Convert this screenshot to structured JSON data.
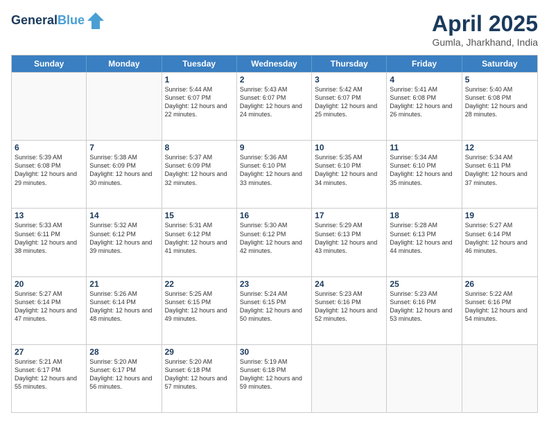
{
  "header": {
    "logo_line1": "General",
    "logo_line2": "Blue",
    "month": "April 2025",
    "location": "Gumla, Jharkhand, India"
  },
  "days_of_week": [
    "Sunday",
    "Monday",
    "Tuesday",
    "Wednesday",
    "Thursday",
    "Friday",
    "Saturday"
  ],
  "weeks": [
    [
      {
        "day": "",
        "info": ""
      },
      {
        "day": "",
        "info": ""
      },
      {
        "day": "1",
        "info": "Sunrise: 5:44 AM\nSunset: 6:07 PM\nDaylight: 12 hours and 22 minutes."
      },
      {
        "day": "2",
        "info": "Sunrise: 5:43 AM\nSunset: 6:07 PM\nDaylight: 12 hours and 24 minutes."
      },
      {
        "day": "3",
        "info": "Sunrise: 5:42 AM\nSunset: 6:07 PM\nDaylight: 12 hours and 25 minutes."
      },
      {
        "day": "4",
        "info": "Sunrise: 5:41 AM\nSunset: 6:08 PM\nDaylight: 12 hours and 26 minutes."
      },
      {
        "day": "5",
        "info": "Sunrise: 5:40 AM\nSunset: 6:08 PM\nDaylight: 12 hours and 28 minutes."
      }
    ],
    [
      {
        "day": "6",
        "info": "Sunrise: 5:39 AM\nSunset: 6:08 PM\nDaylight: 12 hours and 29 minutes."
      },
      {
        "day": "7",
        "info": "Sunrise: 5:38 AM\nSunset: 6:09 PM\nDaylight: 12 hours and 30 minutes."
      },
      {
        "day": "8",
        "info": "Sunrise: 5:37 AM\nSunset: 6:09 PM\nDaylight: 12 hours and 32 minutes."
      },
      {
        "day": "9",
        "info": "Sunrise: 5:36 AM\nSunset: 6:10 PM\nDaylight: 12 hours and 33 minutes."
      },
      {
        "day": "10",
        "info": "Sunrise: 5:35 AM\nSunset: 6:10 PM\nDaylight: 12 hours and 34 minutes."
      },
      {
        "day": "11",
        "info": "Sunrise: 5:34 AM\nSunset: 6:10 PM\nDaylight: 12 hours and 35 minutes."
      },
      {
        "day": "12",
        "info": "Sunrise: 5:34 AM\nSunset: 6:11 PM\nDaylight: 12 hours and 37 minutes."
      }
    ],
    [
      {
        "day": "13",
        "info": "Sunrise: 5:33 AM\nSunset: 6:11 PM\nDaylight: 12 hours and 38 minutes."
      },
      {
        "day": "14",
        "info": "Sunrise: 5:32 AM\nSunset: 6:12 PM\nDaylight: 12 hours and 39 minutes."
      },
      {
        "day": "15",
        "info": "Sunrise: 5:31 AM\nSunset: 6:12 PM\nDaylight: 12 hours and 41 minutes."
      },
      {
        "day": "16",
        "info": "Sunrise: 5:30 AM\nSunset: 6:12 PM\nDaylight: 12 hours and 42 minutes."
      },
      {
        "day": "17",
        "info": "Sunrise: 5:29 AM\nSunset: 6:13 PM\nDaylight: 12 hours and 43 minutes."
      },
      {
        "day": "18",
        "info": "Sunrise: 5:28 AM\nSunset: 6:13 PM\nDaylight: 12 hours and 44 minutes."
      },
      {
        "day": "19",
        "info": "Sunrise: 5:27 AM\nSunset: 6:14 PM\nDaylight: 12 hours and 46 minutes."
      }
    ],
    [
      {
        "day": "20",
        "info": "Sunrise: 5:27 AM\nSunset: 6:14 PM\nDaylight: 12 hours and 47 minutes."
      },
      {
        "day": "21",
        "info": "Sunrise: 5:26 AM\nSunset: 6:14 PM\nDaylight: 12 hours and 48 minutes."
      },
      {
        "day": "22",
        "info": "Sunrise: 5:25 AM\nSunset: 6:15 PM\nDaylight: 12 hours and 49 minutes."
      },
      {
        "day": "23",
        "info": "Sunrise: 5:24 AM\nSunset: 6:15 PM\nDaylight: 12 hours and 50 minutes."
      },
      {
        "day": "24",
        "info": "Sunrise: 5:23 AM\nSunset: 6:16 PM\nDaylight: 12 hours and 52 minutes."
      },
      {
        "day": "25",
        "info": "Sunrise: 5:23 AM\nSunset: 6:16 PM\nDaylight: 12 hours and 53 minutes."
      },
      {
        "day": "26",
        "info": "Sunrise: 5:22 AM\nSunset: 6:16 PM\nDaylight: 12 hours and 54 minutes."
      }
    ],
    [
      {
        "day": "27",
        "info": "Sunrise: 5:21 AM\nSunset: 6:17 PM\nDaylight: 12 hours and 55 minutes."
      },
      {
        "day": "28",
        "info": "Sunrise: 5:20 AM\nSunset: 6:17 PM\nDaylight: 12 hours and 56 minutes."
      },
      {
        "day": "29",
        "info": "Sunrise: 5:20 AM\nSunset: 6:18 PM\nDaylight: 12 hours and 57 minutes."
      },
      {
        "day": "30",
        "info": "Sunrise: 5:19 AM\nSunset: 6:18 PM\nDaylight: 12 hours and 59 minutes."
      },
      {
        "day": "",
        "info": ""
      },
      {
        "day": "",
        "info": ""
      },
      {
        "day": "",
        "info": ""
      }
    ]
  ]
}
